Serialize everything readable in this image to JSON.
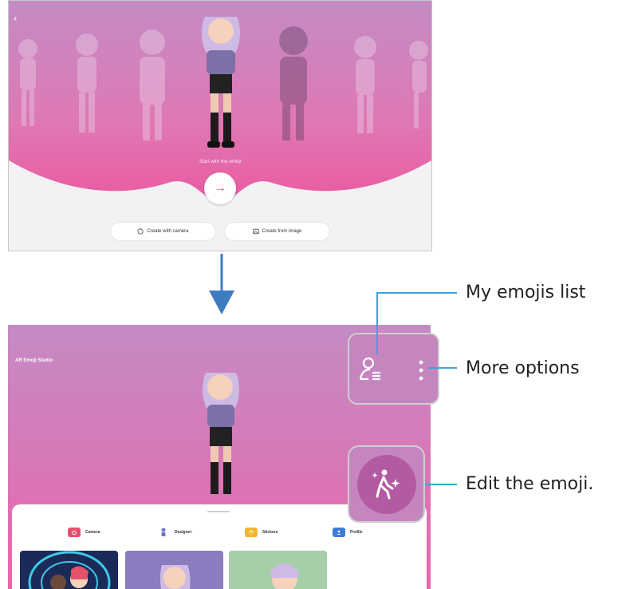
{
  "top_screen": {
    "back_icon": "chevron-left-icon",
    "prompt": "Start with this emoji",
    "next_icon": "arrow-right-icon",
    "create_with_camera": "Create with camera",
    "create_from_image": "Create from image"
  },
  "flow_arrow_icon": "arrow-down-icon",
  "bottom_screen": {
    "app_title": "AR Emoji Studio",
    "menu": [
      {
        "label": "Camera",
        "icon": "camera-icon",
        "color": "#e8506a"
      },
      {
        "label": "Designer",
        "icon": "designer-icon",
        "color": "#6a74c9"
      },
      {
        "label": "Stickers",
        "icon": "stickers-icon",
        "color": "#f2b233"
      },
      {
        "label": "Profile",
        "icon": "profile-icon",
        "color": "#3e7bd8"
      }
    ]
  },
  "callouts": {
    "my_emojis_list": "My emojis list",
    "more_options": "More options",
    "edit_emoji": "Edit the emoji."
  },
  "colors": {
    "callout_line": "#3aa6d8",
    "accent_pink": "#e8506a",
    "hero_purple": "#c586c0"
  }
}
